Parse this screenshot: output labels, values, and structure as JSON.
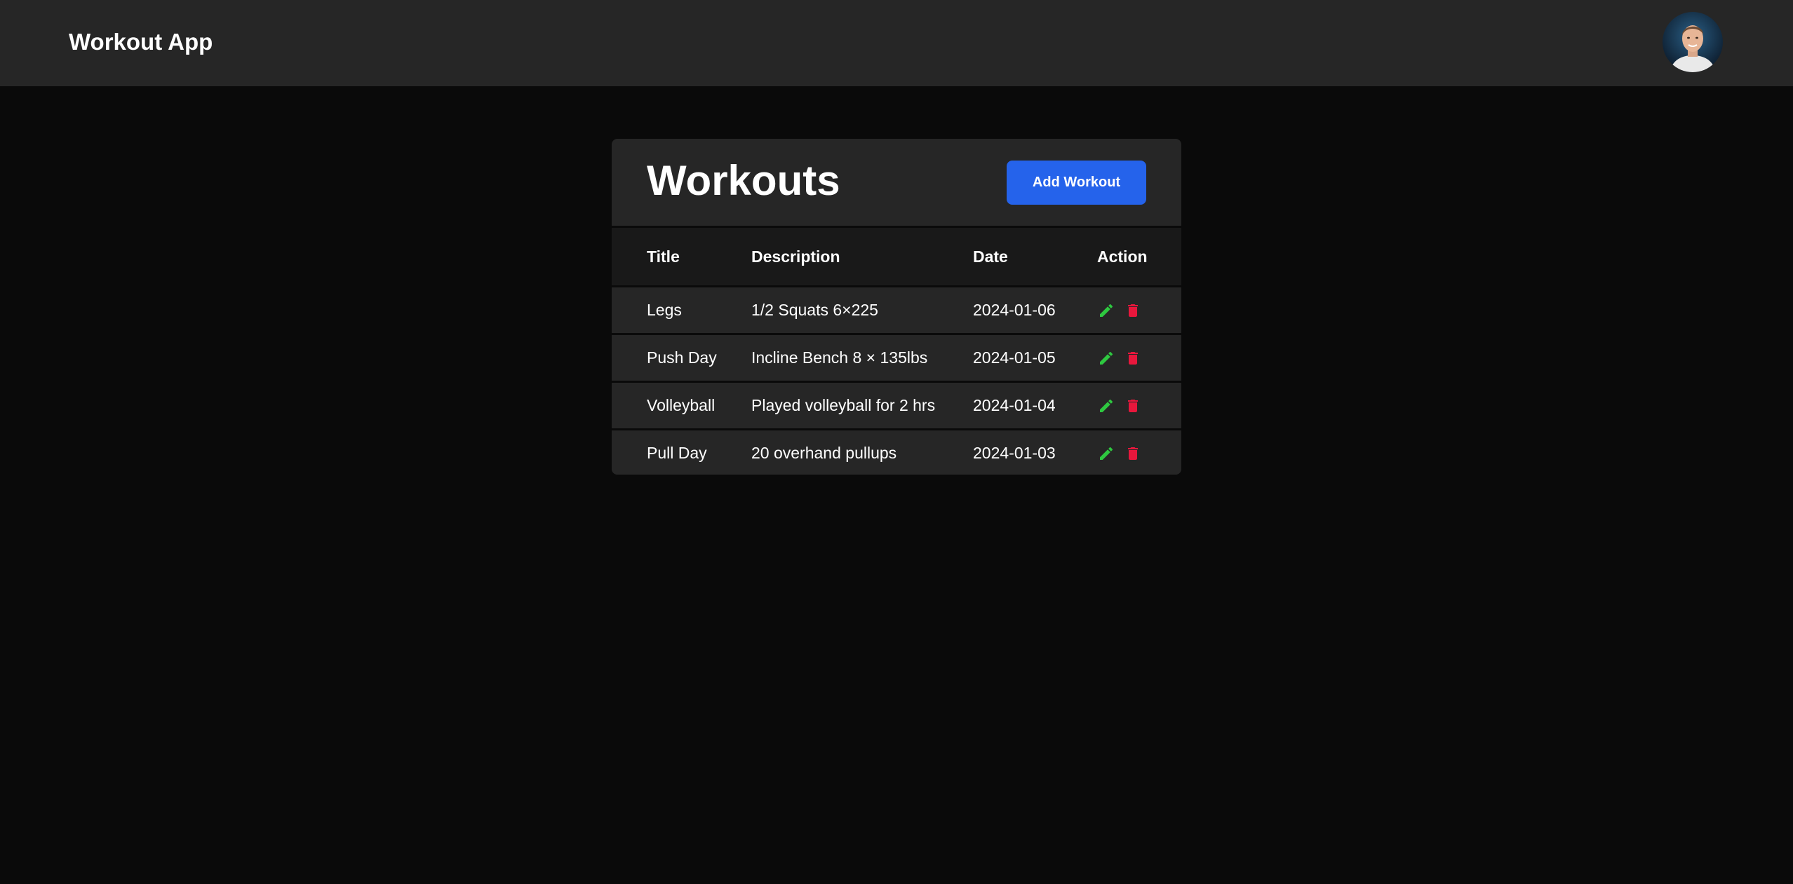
{
  "app": {
    "title": "Workout App"
  },
  "user": {
    "avatar_alt": "user avatar"
  },
  "workouts": {
    "heading": "Workouts",
    "add_button_label": "Add Workout",
    "columns": {
      "title": "Title",
      "description": "Description",
      "date": "Date",
      "action": "Action"
    },
    "rows": [
      {
        "title": "Legs",
        "description": "1/2 Squats 6×225",
        "date": "2024-01-06"
      },
      {
        "title": "Push Day",
        "description": "Incline Bench 8 × 135lbs",
        "date": "2024-01-05"
      },
      {
        "title": "Volleyball",
        "description": "Played volleyball for 2 hrs",
        "date": "2024-01-04"
      },
      {
        "title": "Pull Day",
        "description": "20 overhand pullups",
        "date": "2024-01-03"
      }
    ]
  },
  "icons": {
    "edit": "pencil-icon",
    "delete": "trash-icon"
  },
  "colors": {
    "background": "#0a0a0a",
    "topbar": "#262626",
    "card": "#262626",
    "header_row": "#191919",
    "accent_button": "#2563eb",
    "edit_icon": "#2ec840",
    "delete_icon": "#e8173c"
  }
}
